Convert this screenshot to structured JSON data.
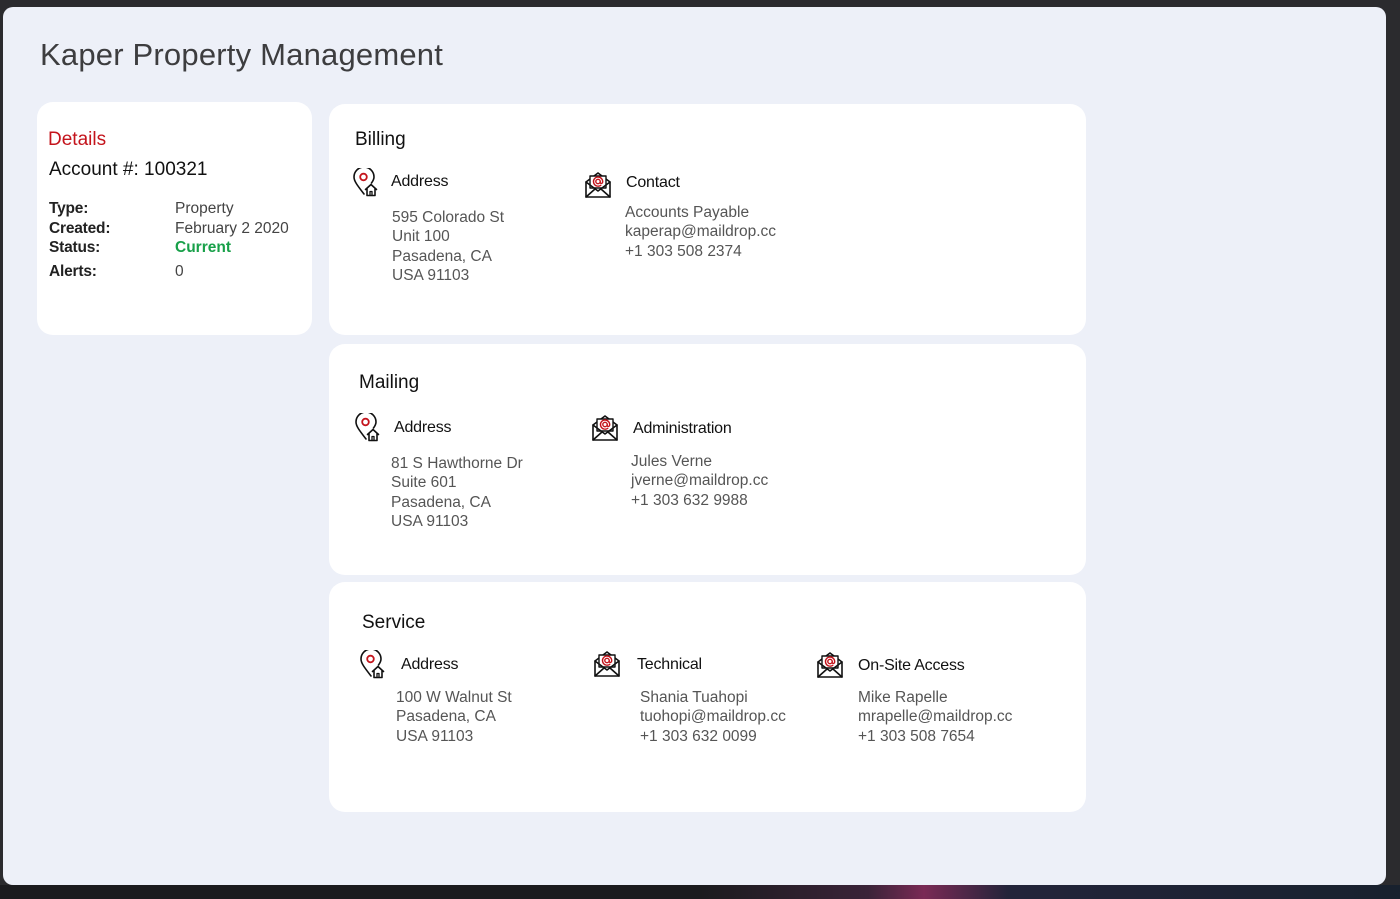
{
  "app": {
    "title": "Kaper Property Management"
  },
  "details": {
    "heading": "Details",
    "account": "Account #: 100321",
    "rows": [
      {
        "label": "Type:",
        "value": "Property"
      },
      {
        "label": "Created:",
        "value": "February 2 2020"
      },
      {
        "label": "Status:",
        "value": "Current"
      },
      {
        "label": "Alerts:",
        "value": "0"
      }
    ],
    "status_color": "#18a049"
  },
  "billing": {
    "title": "Billing",
    "address": {
      "label": "Address",
      "icon": "map-pin-house-icon",
      "lines": [
        "595 Colorado St",
        "Unit 100",
        "Pasadena, CA",
        "USA 91103"
      ]
    },
    "contact": {
      "label": "Contact",
      "icon": "email-envelope-icon",
      "lines": [
        "Accounts Payable",
        "kaperap@maildrop.cc",
        "+1 303 508 2374"
      ]
    }
  },
  "mailing": {
    "title": "Mailing",
    "address": {
      "label": "Address",
      "icon": "map-pin-house-icon",
      "lines": [
        "81 S Hawthorne Dr",
        "Suite 601",
        "Pasadena, CA",
        "USA 91103"
      ]
    },
    "administration": {
      "label": "Administration",
      "icon": "email-envelope-icon",
      "lines": [
        "Jules Verne",
        "jverne@maildrop.cc",
        "+1 303 632 9988"
      ]
    }
  },
  "service": {
    "title": "Service",
    "address": {
      "label": "Address",
      "icon": "map-pin-house-icon",
      "lines": [
        "100 W Walnut St",
        "Pasadena, CA",
        "USA 91103"
      ]
    },
    "technical": {
      "label": "Technical",
      "icon": "email-envelope-icon",
      "lines": [
        "Shania Tuahopi",
        "tuohopi@maildrop.cc",
        "+1 303 632 0099"
      ]
    },
    "onsite": {
      "label": "On-Site Access",
      "icon": "email-envelope-icon",
      "lines": [
        "Mike Rapelle",
        "mrapelle@maildrop.cc",
        "+1 303 508 7654"
      ]
    }
  },
  "colors": {
    "accent": "#c4141c",
    "background": "#edf0f8",
    "card": "#ffffff",
    "success": "#18a049"
  }
}
